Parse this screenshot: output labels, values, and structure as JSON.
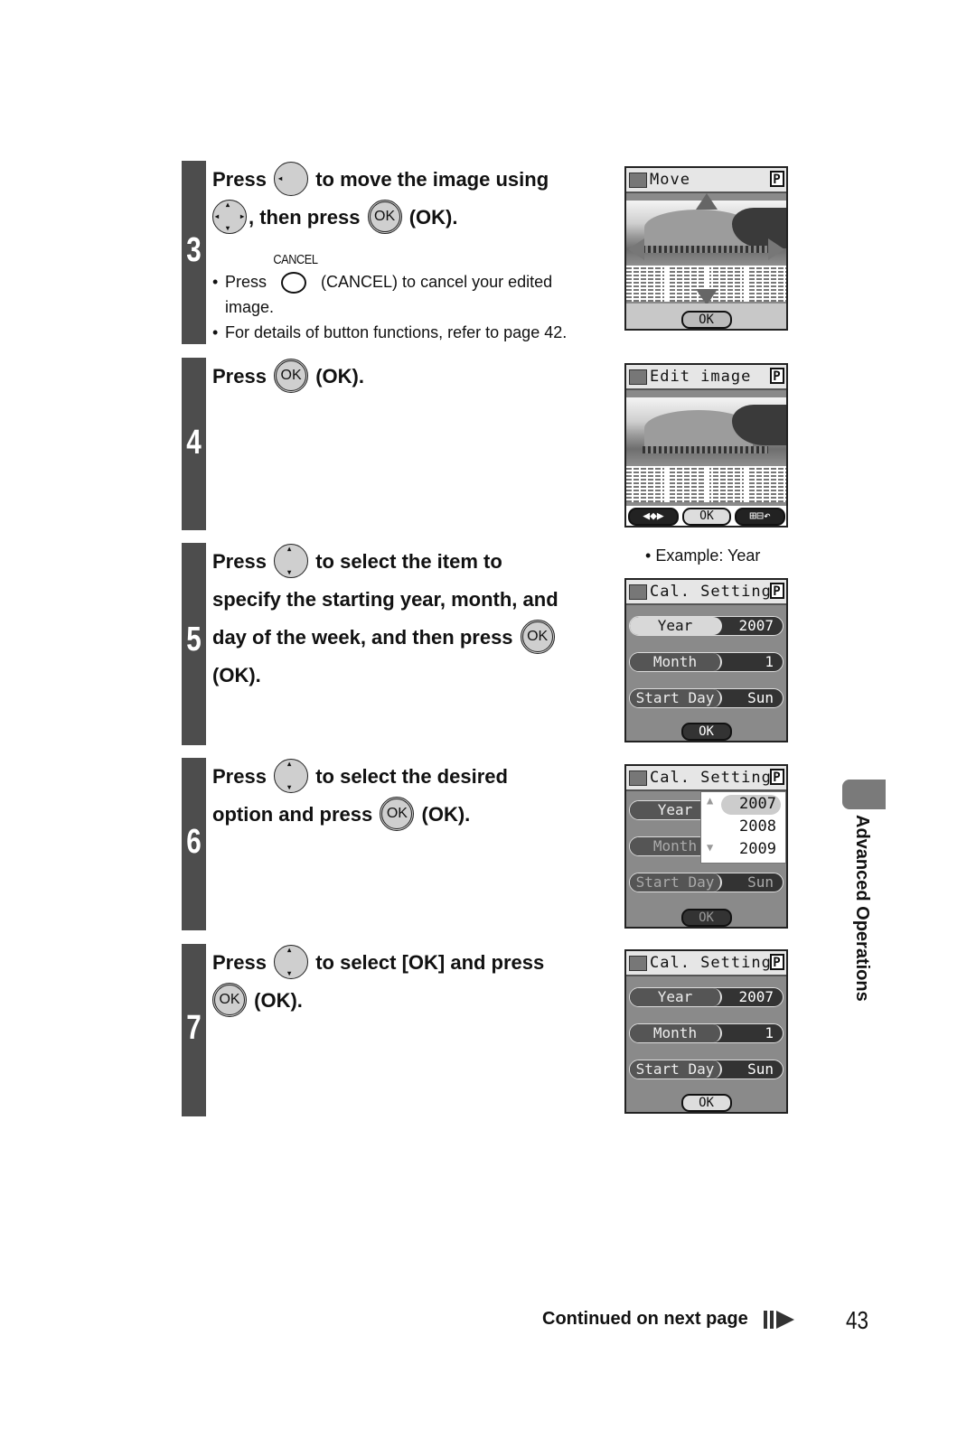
{
  "steps": [
    {
      "number": "3",
      "text_parts": [
        "Press",
        "to move the image using",
        ", then press",
        "(OK)."
      ],
      "notes": [
        {
          "prefix": "Press",
          "button_label": "CANCEL",
          "suffix": "(CANCEL) to cancel your edited",
          "cont": "image."
        },
        {
          "text": "For details of button functions, refer to page 42."
        }
      ],
      "screen": {
        "title": "Move",
        "badge": "P",
        "ok_label": "OK"
      }
    },
    {
      "number": "4",
      "text_parts": [
        "Press",
        "(OK)."
      ],
      "screen": {
        "title": "Edit image",
        "badge": "P",
        "softkeys": [
          "◀◆▶",
          "OK",
          "⊞⊟↶"
        ]
      }
    },
    {
      "number": "5",
      "lines": [
        "to select the item to",
        "specify the starting year, month, and",
        "day of the week, and then press",
        "(OK)."
      ],
      "press": "Press",
      "example": "Example: Year",
      "screen": {
        "title": "Cal. Settings",
        "badge": "P",
        "rows": [
          {
            "label": "Year",
            "value": "2007",
            "state": "selected"
          },
          {
            "label": "Month",
            "value": "1",
            "state": "normal"
          },
          {
            "label": "Start Day",
            "value": "Sun",
            "state": "normal"
          }
        ],
        "ok_label": "OK"
      }
    },
    {
      "number": "6",
      "press": "Press",
      "line1": "to select the desired",
      "line2_pre": "option and press",
      "line2_post": "(OK).",
      "screen": {
        "title": "Cal. Settings",
        "badge": "P",
        "rows": [
          {
            "label": "Year",
            "value": "",
            "state": "normal"
          },
          {
            "label": "Month",
            "value": "",
            "state": "dim"
          },
          {
            "label": "Start Day",
            "value": "Sun",
            "state": "dim"
          }
        ],
        "dropdown_options": [
          "2007",
          "2008",
          "2009"
        ],
        "dropdown_selected": "2007",
        "ok_label": "OK"
      }
    },
    {
      "number": "7",
      "press": "Press",
      "line1": "to select [OK] and press",
      "line2_post": "(OK).",
      "screen": {
        "title": "Cal. Settings",
        "badge": "P",
        "rows": [
          {
            "label": "Year",
            "value": "2007",
            "state": "normal"
          },
          {
            "label": "Month",
            "value": "1",
            "state": "normal"
          },
          {
            "label": "Start Day",
            "value": "Sun",
            "state": "normal"
          }
        ],
        "ok_label": "OK"
      }
    }
  ],
  "buttons": {
    "ok_glyph": "OK"
  },
  "side_tab": {
    "label": "Advanced Operations",
    "color": "#7a7a7a"
  },
  "footer": {
    "continued": "Continued on next page",
    "page_number": "43"
  },
  "colors": {
    "step_bar": "#4d4d4d",
    "button_fill": "#cfcfcf"
  }
}
